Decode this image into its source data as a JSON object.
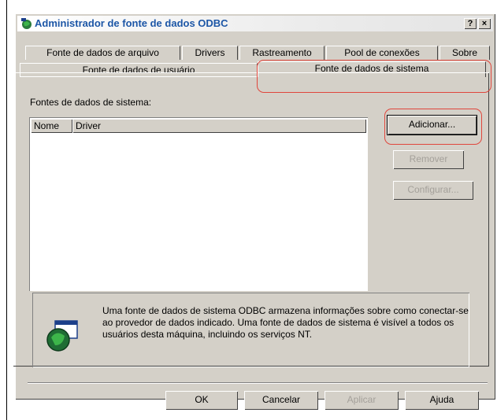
{
  "window": {
    "title": "Administrador de fonte de dados ODBC",
    "help_btn": "?",
    "close_btn": "×"
  },
  "tabs_back": [
    "Fonte de dados de arquivo",
    "Drivers",
    "Rastreamento",
    "Pool de conexões",
    "Sobre"
  ],
  "tabs_front": [
    "Fonte de dados de usuário",
    "Fonte de dados de sistema"
  ],
  "panel": {
    "label": "Fontes de dados de sistema:",
    "columns": [
      "Nome",
      "Driver"
    ]
  },
  "side_buttons": {
    "add": "Adicionar...",
    "remove": "Remover",
    "configure": "Configurar..."
  },
  "info": "Uma fonte de dados de sistema ODBC armazena informações sobre como conectar-se ao provedor de dados indicado. Uma fonte de dados de sistema é visível a todos os usuários desta máquina, incluindo os serviços NT.",
  "footer_buttons": {
    "ok": "OK",
    "cancel": "Cancelar",
    "apply": "Aplicar",
    "help": "Ajuda"
  },
  "accent": "#e0463c"
}
